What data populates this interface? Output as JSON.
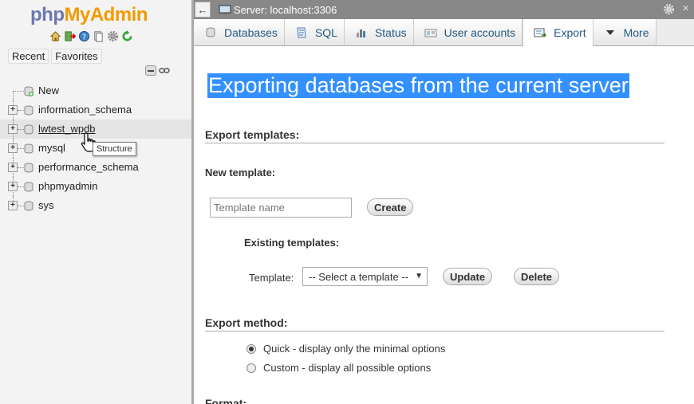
{
  "logo": {
    "php": "php",
    "admin": "MyAdmin"
  },
  "nav": {
    "recent": "Recent",
    "favorites": "Favorites"
  },
  "tree": {
    "new_label": "New",
    "databases": [
      "information_schema",
      "lwtest_wpdb",
      "mysql",
      "performance_schema",
      "phpmyadmin",
      "sys"
    ],
    "hovered": "lwtest_wpdb",
    "tooltip": "Structure"
  },
  "serverbar": {
    "label": "Server: localhost:3306"
  },
  "tabs": [
    {
      "label": "Databases",
      "icon": "database-icon"
    },
    {
      "label": "SQL",
      "icon": "sql-icon"
    },
    {
      "label": "Status",
      "icon": "status-icon"
    },
    {
      "label": "User accounts",
      "icon": "user-accounts-icon"
    },
    {
      "label": "Export",
      "icon": "export-icon",
      "active": true
    },
    {
      "label": "More",
      "icon": "chevron-down-icon"
    }
  ],
  "main": {
    "title": "Exporting databases from the current server",
    "export_templates_heading": "Export templates:",
    "new_template_heading": "New template:",
    "template_name_placeholder": "Template name",
    "create_label": "Create",
    "existing_templates_heading": "Existing templates:",
    "template_label": "Template:",
    "template_select_value": "-- Select a template --",
    "update_label": "Update",
    "delete_label": "Delete",
    "export_method_heading": "Export method:",
    "method_quick": "Quick - display only the minimal options",
    "method_custom": "Custom - display all possible options",
    "format_heading": "Format:"
  },
  "colors": {
    "title_highlight": "#3390ff",
    "tab_text": "#235a81",
    "logo_php": "#6c78af",
    "logo_admin": "#f29a00"
  }
}
